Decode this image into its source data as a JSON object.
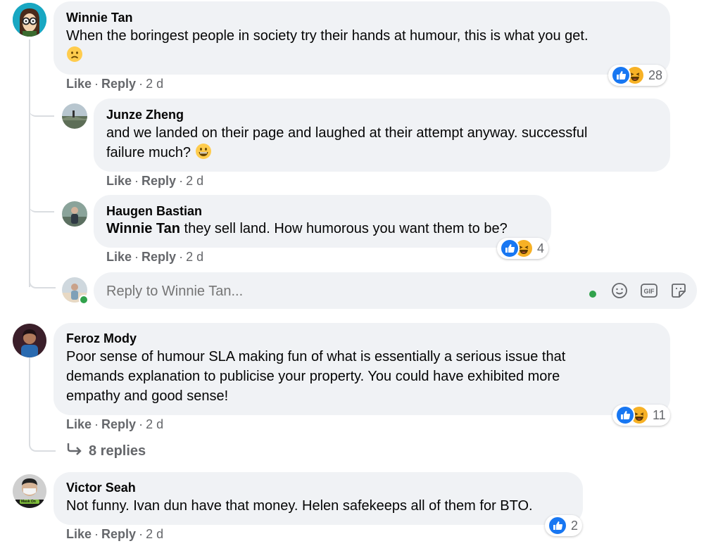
{
  "actions": {
    "like": "Like",
    "reply": "Reply",
    "dot": "·"
  },
  "comments": [
    {
      "author": "Winnie Tan",
      "text": "When the boringest people in society try their hands at humour, this is what you get.",
      "emoji": "frowning-face",
      "time": "2 d",
      "reaction_count": "28"
    },
    {
      "author": "Junze Zheng",
      "text_line1": "and we landed on their page and laughed at their attempt anyway. successful",
      "text_line2": "failure much?",
      "emoji": "grinning-face",
      "time": "2 d"
    },
    {
      "author": "Haugen Bastian",
      "mention": "Winnie Tan",
      "text": " they sell land. How humorous you want them to be?",
      "time": "2 d",
      "reaction_count": "4"
    },
    {
      "author": "Feroz Mody",
      "text_line1": "Poor sense of humour SLA making fun of what is essentially a serious issue that",
      "text_line2": "demands explanation to publicise your property. You could have exhibited more",
      "text_line3": "empathy and good sense!",
      "time": "2 d",
      "reaction_count": "11",
      "replies_label": "8 replies"
    },
    {
      "author": "Victor Seah",
      "text": "Not funny. Ivan dun have that money. Helen safekeeps all of them for BTO.",
      "time": "2 d",
      "reaction_count": "2",
      "avatar_caption": "Mask On"
    }
  ],
  "reply_box": {
    "placeholder": "Reply to Winnie Tan..."
  },
  "colors": {
    "like_blue": "#1877f2",
    "haha_yellow": "#f7b125",
    "online_green": "#31a24c",
    "bubble": "#f0f2f5",
    "meta_gray": "#65676b"
  }
}
